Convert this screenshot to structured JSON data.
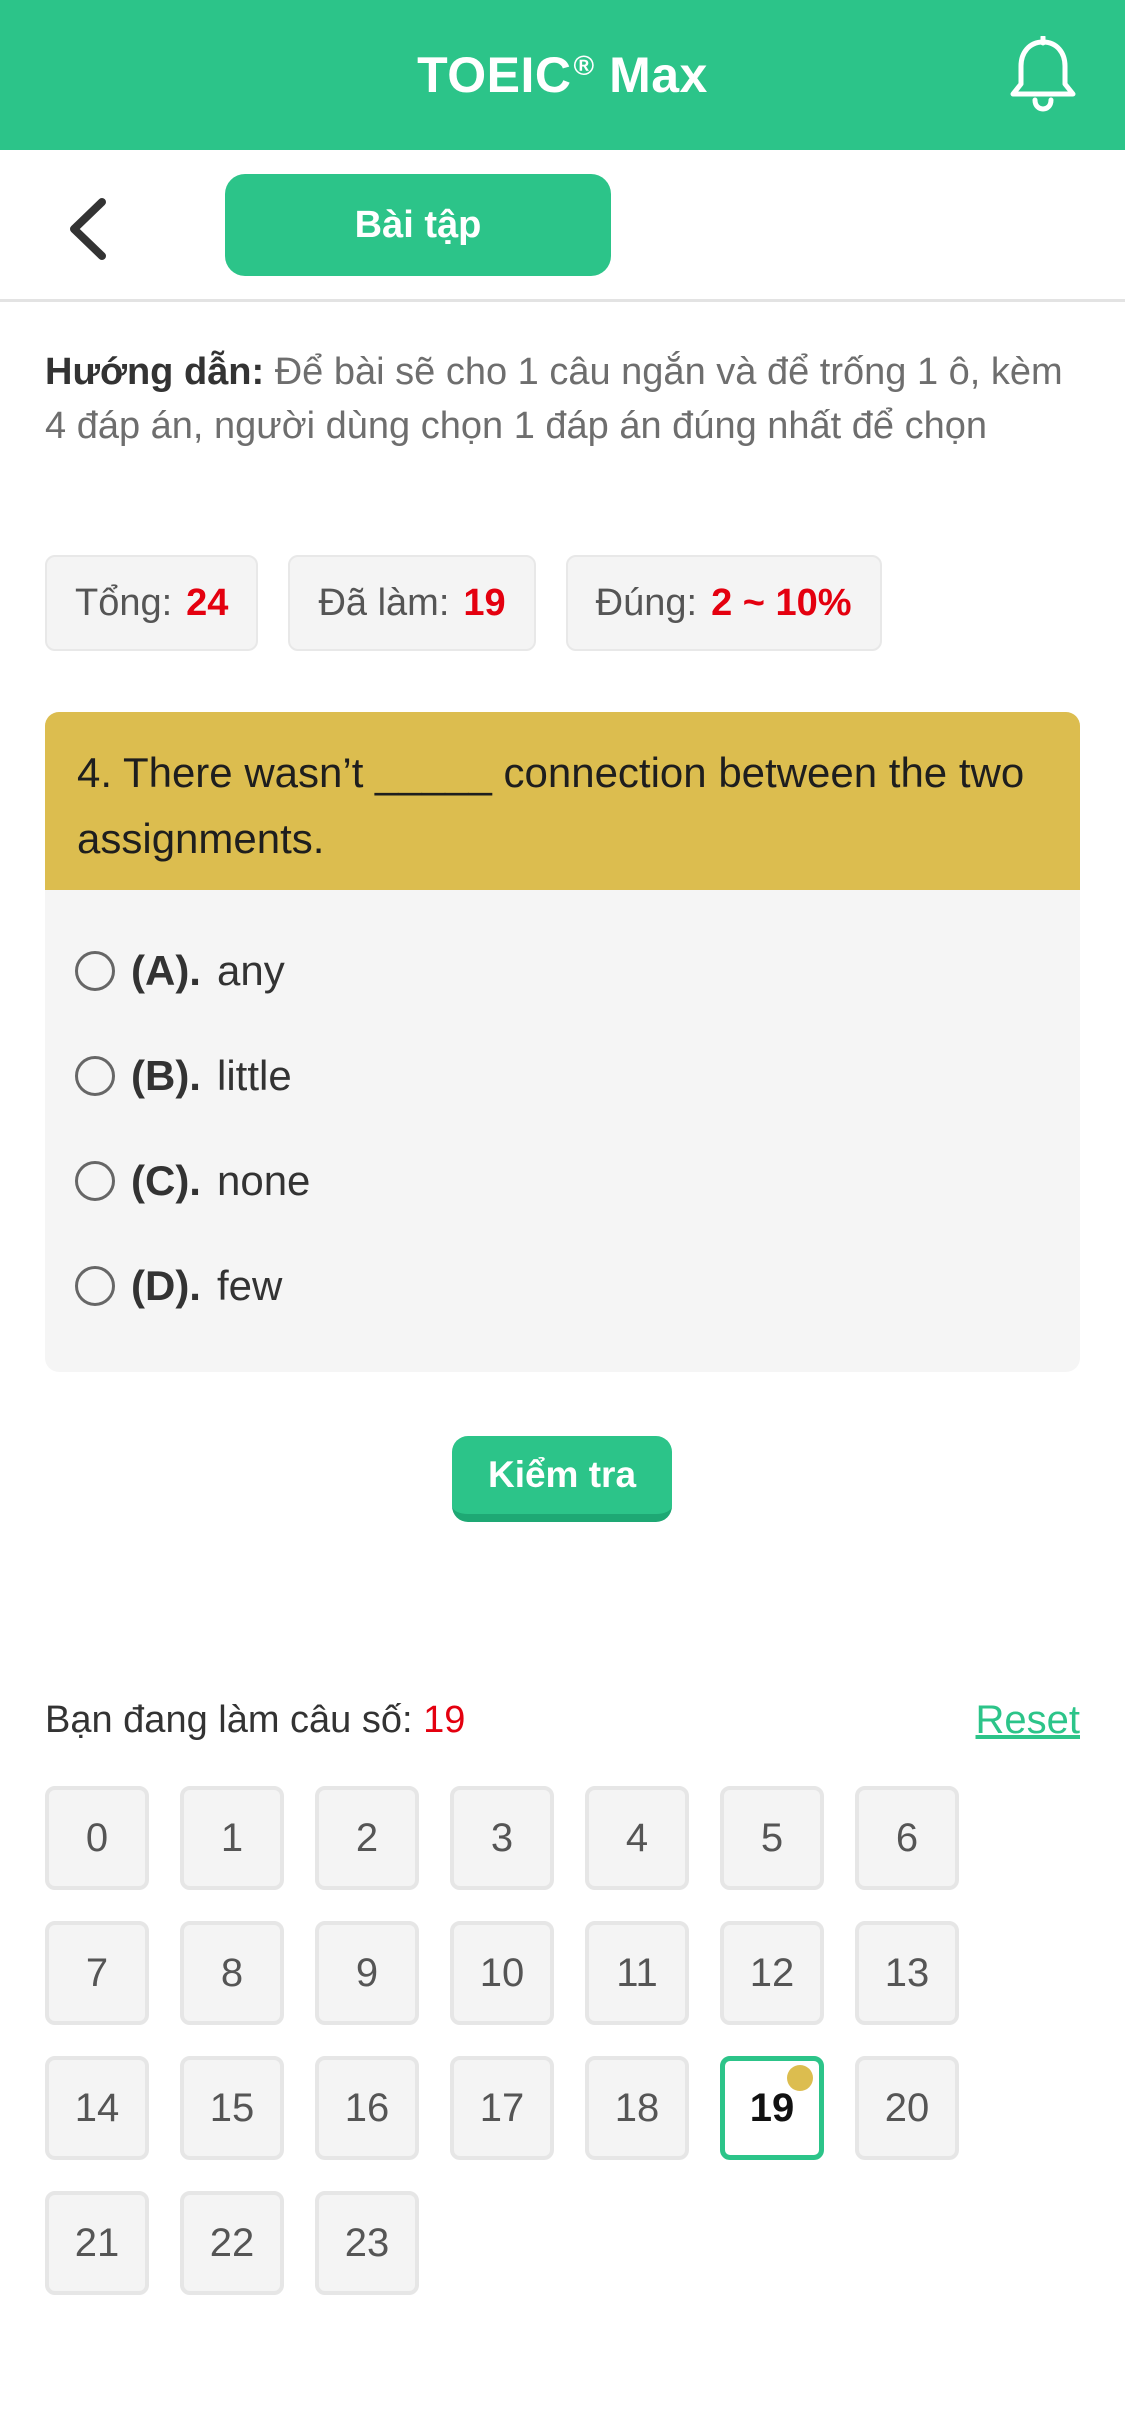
{
  "header": {
    "title": "TOEIC",
    "title_mark": "®",
    "title_suffix": " Max",
    "bell_icon": "bell-icon",
    "color": "#2cc489"
  },
  "toolbar": {
    "back_icon": "chevron-left-icon",
    "tab_label": "Bài tập"
  },
  "instructions": {
    "label": "Hướng dẫn:",
    "text": " Để bài sẽ cho 1 câu ngắn và để trống 1 ô, kèm 4 đáp án, người dùng chọn 1 đáp án đúng nhất để chọn"
  },
  "stats": [
    {
      "label": "Tổng:",
      "value": "24"
    },
    {
      "label": "Đã làm:",
      "value": "19"
    },
    {
      "label": "Đúng:",
      "value": "2 ~ 10%"
    }
  ],
  "question": {
    "text": "4. There wasn’t _____ connection between the two assignments.",
    "options": [
      {
        "letter": "(A).",
        "text": "any"
      },
      {
        "letter": "(B).",
        "text": "little"
      },
      {
        "letter": "(C).",
        "text": "none"
      },
      {
        "letter": "(D).",
        "text": "few"
      }
    ]
  },
  "check_button": "Kiểm tra",
  "progress": {
    "label": "Bạn đang làm câu số:",
    "current": "19",
    "reset": "Reset"
  },
  "grid": {
    "numbers": [
      "0",
      "1",
      "2",
      "3",
      "4",
      "5",
      "6",
      "7",
      "8",
      "9",
      "10",
      "11",
      "12",
      "13",
      "14",
      "15",
      "16",
      "17",
      "18",
      "19",
      "20",
      "21",
      "22",
      "23"
    ],
    "active": "19"
  }
}
